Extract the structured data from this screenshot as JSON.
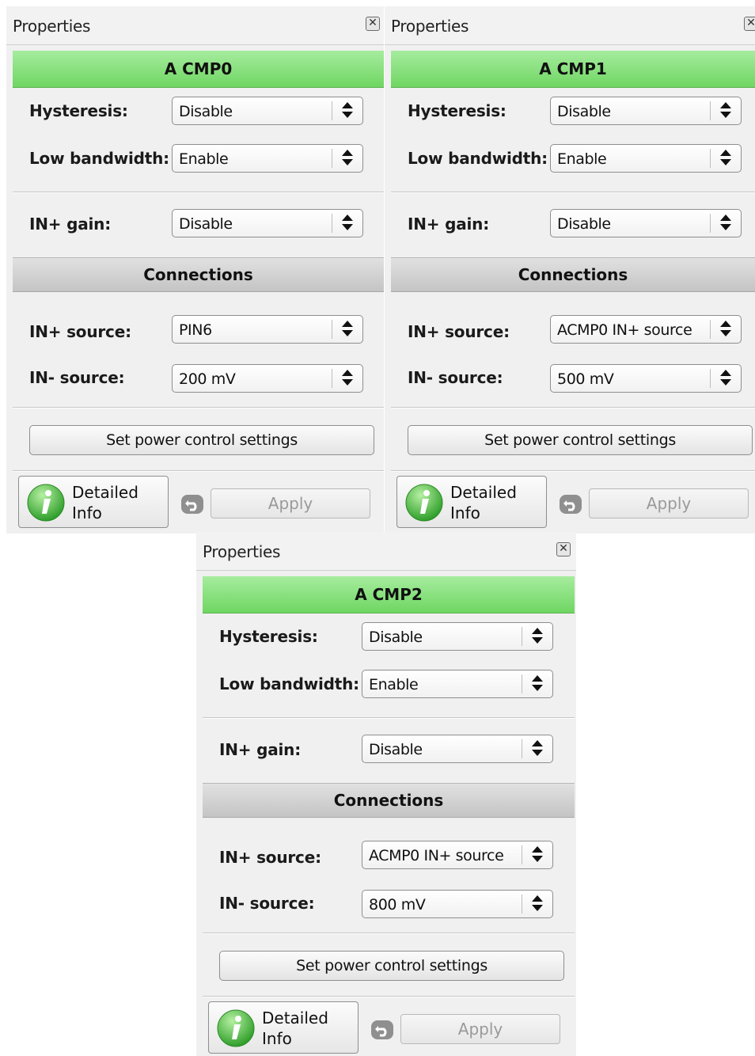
{
  "panels": [
    {
      "window_title": "Properties",
      "header": "A CMP0",
      "fields": {
        "hysteresis": {
          "label": "Hysteresis:",
          "value": "Disable"
        },
        "low_bandwidth": {
          "label": "Low bandwidth:",
          "value": "Enable"
        },
        "in_plus_gain": {
          "label": "IN+ gain:",
          "value": "Disable"
        },
        "in_plus_source": {
          "label": "IN+ source:",
          "value": "PIN6"
        },
        "in_minus_source": {
          "label": "IN- source:",
          "value": "200 mV"
        }
      },
      "connections_label": "Connections",
      "power_button": "Set power control settings",
      "detailed_info": [
        "Detailed",
        "Info"
      ],
      "apply_label": "Apply"
    },
    {
      "window_title": "Properties",
      "header": "A CMP1",
      "fields": {
        "hysteresis": {
          "label": "Hysteresis:",
          "value": "Disable"
        },
        "low_bandwidth": {
          "label": "Low bandwidth:",
          "value": "Enable"
        },
        "in_plus_gain": {
          "label": "IN+ gain:",
          "value": "Disable"
        },
        "in_plus_source": {
          "label": "IN+ source:",
          "value": "ACMP0 IN+ source"
        },
        "in_minus_source": {
          "label": "IN- source:",
          "value": "500 mV"
        }
      },
      "connections_label": "Connections",
      "power_button": "Set power control settings",
      "detailed_info": [
        "Detailed",
        "Info"
      ],
      "apply_label": "Apply"
    },
    {
      "window_title": "Properties",
      "header": "A CMP2",
      "fields": {
        "hysteresis": {
          "label": "Hysteresis:",
          "value": "Disable"
        },
        "low_bandwidth": {
          "label": "Low bandwidth:",
          "value": "Enable"
        },
        "in_plus_gain": {
          "label": "IN+ gain:",
          "value": "Disable"
        },
        "in_plus_source": {
          "label": "IN+ source:",
          "value": "ACMP0 IN+ source"
        },
        "in_minus_source": {
          "label": "IN- source:",
          "value": "800 mV"
        }
      },
      "connections_label": "Connections",
      "power_button": "Set power control settings",
      "detailed_info": [
        "Detailed",
        "Info"
      ],
      "apply_label": "Apply"
    }
  ],
  "icons": {
    "close": "close-icon",
    "info": "info-icon",
    "undo": "undo-icon",
    "updown": "updown-arrows-icon"
  },
  "colors": {
    "header_green": "#7ad96e",
    "section_gray": "#cdcdcd",
    "panel_bg": "#f0f0f0",
    "disabled_text": "#9a9a9a"
  }
}
